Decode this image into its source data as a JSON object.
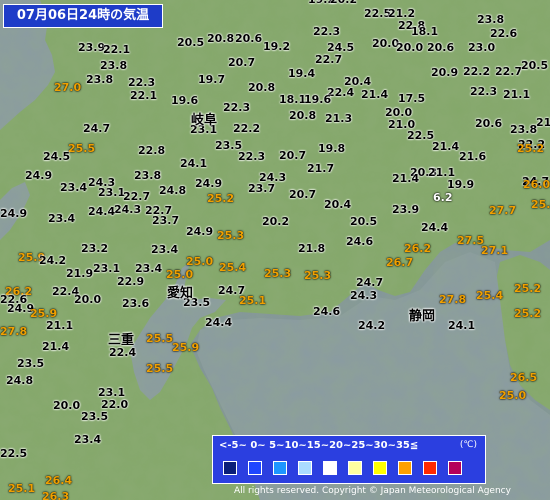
{
  "title": "07月06日24時の気温",
  "cities": [
    {
      "name": "岐阜",
      "id": "gifu"
    },
    {
      "name": "愛知",
      "id": "aichi"
    },
    {
      "name": "三重",
      "id": "mie"
    },
    {
      "name": "静岡",
      "id": "shizuoka"
    }
  ],
  "temperatures": [
    {
      "id": "t1",
      "value": "19.2"
    },
    {
      "id": "t2",
      "value": "20.2"
    },
    {
      "id": "t3",
      "value": "22.5"
    },
    {
      "id": "t4",
      "value": "21.2"
    },
    {
      "id": "t5",
      "value": "22.8"
    },
    {
      "id": "t6",
      "value": "23.8"
    },
    {
      "id": "t7",
      "value": "22.6"
    },
    {
      "id": "t8",
      "value": "20.5"
    },
    {
      "id": "t9",
      "value": "20.8"
    },
    {
      "id": "t10",
      "value": "20.6"
    },
    {
      "id": "t11",
      "value": "19.2"
    },
    {
      "id": "t12",
      "value": "22.3"
    },
    {
      "id": "t13",
      "value": "20.0"
    },
    {
      "id": "t14",
      "value": "18.1"
    },
    {
      "id": "t15",
      "value": "20.0"
    },
    {
      "id": "t16",
      "value": "20.6"
    },
    {
      "id": "t17",
      "value": "23.0"
    },
    {
      "id": "t18",
      "value": "23.9"
    },
    {
      "id": "t19",
      "value": "22.1"
    },
    {
      "id": "t20",
      "value": "24.5"
    },
    {
      "id": "t21",
      "value": "22.7"
    },
    {
      "id": "t22",
      "value": "20.7"
    },
    {
      "id": "t23",
      "value": "23.8"
    },
    {
      "id": "t24",
      "value": "19.4"
    },
    {
      "id": "t25",
      "value": "20.9"
    },
    {
      "id": "t26",
      "value": "22.2"
    },
    {
      "id": "t27",
      "value": "22.7"
    },
    {
      "id": "t28",
      "value": "20.5"
    },
    {
      "id": "t29",
      "value": "23.8"
    },
    {
      "id": "t30",
      "value": "19.7"
    },
    {
      "id": "t31",
      "value": "20.4"
    },
    {
      "id": "t32",
      "value": "27.0"
    },
    {
      "id": "t33",
      "value": "22.3"
    },
    {
      "id": "t34",
      "value": "20.8"
    },
    {
      "id": "t35",
      "value": "22.3"
    },
    {
      "id": "t36",
      "value": "22.1"
    },
    {
      "id": "t37",
      "value": "21.1"
    },
    {
      "id": "t38",
      "value": "22.4"
    },
    {
      "id": "t39",
      "value": "21.4"
    },
    {
      "id": "t40",
      "value": "17.5"
    },
    {
      "id": "t41",
      "value": "19.6"
    },
    {
      "id": "t42",
      "value": "18.1"
    },
    {
      "id": "t43",
      "value": "19.6"
    },
    {
      "id": "t44",
      "value": "22.3"
    },
    {
      "id": "t45",
      "value": "20.8"
    },
    {
      "id": "t46",
      "value": "21.3"
    },
    {
      "id": "t47",
      "value": "20.0"
    },
    {
      "id": "t48",
      "value": "21.0"
    },
    {
      "id": "t49",
      "value": "20.6"
    },
    {
      "id": "t50",
      "value": "21.6"
    },
    {
      "id": "t51",
      "value": "24.7"
    },
    {
      "id": "t52",
      "value": "23.1"
    },
    {
      "id": "t53",
      "value": "22.2"
    },
    {
      "id": "t54",
      "value": "23.8"
    },
    {
      "id": "t55",
      "value": "22.5"
    },
    {
      "id": "t56",
      "value": "22.2"
    },
    {
      "id": "t57",
      "value": "25.5"
    },
    {
      "id": "t58",
      "value": "23.5"
    },
    {
      "id": "t59",
      "value": "19.8"
    },
    {
      "id": "t60",
      "value": "21.4"
    },
    {
      "id": "t61",
      "value": "24.5"
    },
    {
      "id": "t62",
      "value": "22.8"
    },
    {
      "id": "t63",
      "value": "22.3"
    },
    {
      "id": "t64",
      "value": "20.7"
    },
    {
      "id": "t65",
      "value": "21.6"
    },
    {
      "id": "t66",
      "value": "25.2"
    },
    {
      "id": "t67",
      "value": "24.1"
    },
    {
      "id": "t68",
      "value": "21.7"
    },
    {
      "id": "t69",
      "value": "24.9"
    },
    {
      "id": "t70",
      "value": "23.8"
    },
    {
      "id": "t71",
      "value": "24.3"
    },
    {
      "id": "t72",
      "value": "24.9"
    },
    {
      "id": "t73",
      "value": "24.3"
    },
    {
      "id": "t74",
      "value": "20.3"
    },
    {
      "id": "t75",
      "value": "21.4"
    },
    {
      "id": "t76",
      "value": "21.1"
    },
    {
      "id": "t77",
      "value": "24.7"
    },
    {
      "id": "t78",
      "value": "23.4"
    },
    {
      "id": "t79",
      "value": "23.1"
    },
    {
      "id": "t80",
      "value": "24.8"
    },
    {
      "id": "t81",
      "value": "23.7"
    },
    {
      "id": "t82",
      "value": "19.9"
    },
    {
      "id": "t83",
      "value": "26.0"
    },
    {
      "id": "t84",
      "value": "22.7"
    },
    {
      "id": "t85",
      "value": "25.2"
    },
    {
      "id": "t86",
      "value": "20.7"
    },
    {
      "id": "t87",
      "value": "6.2"
    },
    {
      "id": "t88",
      "value": "24.3"
    },
    {
      "id": "t89",
      "value": "20.4"
    },
    {
      "id": "t90",
      "value": "22.7"
    },
    {
      "id": "t91",
      "value": "24.9"
    },
    {
      "id": "t92",
      "value": "24.4"
    },
    {
      "id": "t93",
      "value": "23.9"
    },
    {
      "id": "t94",
      "value": "27.7"
    },
    {
      "id": "t95",
      "value": "25.6"
    },
    {
      "id": "t96",
      "value": "23.4"
    },
    {
      "id": "t97",
      "value": "23.7"
    },
    {
      "id": "t98",
      "value": "20.2"
    },
    {
      "id": "t99",
      "value": "20.5"
    },
    {
      "id": "t100",
      "value": "24.4"
    },
    {
      "id": "t101",
      "value": "24.9"
    },
    {
      "id": "t102",
      "value": "25.3"
    },
    {
      "id": "t103",
      "value": "27.5"
    },
    {
      "id": "t104",
      "value": "23.2"
    },
    {
      "id": "t105",
      "value": "24.6"
    },
    {
      "id": "t106",
      "value": "23.4"
    },
    {
      "id": "t107",
      "value": "21.8"
    },
    {
      "id": "t108",
      "value": "26.2"
    },
    {
      "id": "t109",
      "value": "27.1"
    },
    {
      "id": "t110",
      "value": "25.9"
    },
    {
      "id": "t111",
      "value": "24.2"
    },
    {
      "id": "t112",
      "value": "25.0"
    },
    {
      "id": "t113",
      "value": "21.9"
    },
    {
      "id": "t114",
      "value": "23.1"
    },
    {
      "id": "t115",
      "value": "23.4"
    },
    {
      "id": "t116",
      "value": "25.4"
    },
    {
      "id": "t117",
      "value": "26.7"
    },
    {
      "id": "t118",
      "value": "25.0"
    },
    {
      "id": "t119",
      "value": "25.3"
    },
    {
      "id": "t120",
      "value": "25.3"
    },
    {
      "id": "t121",
      "value": "22.9"
    },
    {
      "id": "t122",
      "value": "24.7"
    },
    {
      "id": "t123",
      "value": "26.2"
    },
    {
      "id": "t124",
      "value": "22.4"
    },
    {
      "id": "t125",
      "value": "24.7"
    },
    {
      "id": "t126",
      "value": "24.3"
    },
    {
      "id": "t127",
      "value": "25.4"
    },
    {
      "id": "t128",
      "value": "25.2"
    },
    {
      "id": "t129",
      "value": "22.6"
    },
    {
      "id": "t130",
      "value": "20.0"
    },
    {
      "id": "t131",
      "value": "23.6"
    },
    {
      "id": "t132",
      "value": "23.5"
    },
    {
      "id": "t133",
      "value": "25.1"
    },
    {
      "id": "t134",
      "value": "24.6"
    },
    {
      "id": "t135",
      "value": "27.8"
    },
    {
      "id": "t136",
      "value": "24.9"
    },
    {
      "id": "t137",
      "value": "25.9"
    },
    {
      "id": "t138",
      "value": "25.2"
    },
    {
      "id": "t139",
      "value": "27.8"
    },
    {
      "id": "t140",
      "value": "21.1"
    },
    {
      "id": "t141",
      "value": "24.4"
    },
    {
      "id": "t142",
      "value": "24.2"
    },
    {
      "id": "t143",
      "value": "24.1"
    },
    {
      "id": "t144",
      "value": "25.5"
    },
    {
      "id": "t145",
      "value": "21.4"
    },
    {
      "id": "t146",
      "value": "25.9"
    },
    {
      "id": "t147",
      "value": "22.4"
    },
    {
      "id": "t148",
      "value": "23.5"
    },
    {
      "id": "t149",
      "value": "25.5"
    },
    {
      "id": "t150",
      "value": "24.8"
    },
    {
      "id": "t151",
      "value": "23.1"
    },
    {
      "id": "t152",
      "value": "26.5"
    },
    {
      "id": "t153",
      "value": "20.0"
    },
    {
      "id": "t154",
      "value": "22.0"
    },
    {
      "id": "t155",
      "value": "23.5"
    },
    {
      "id": "t156",
      "value": "25.0"
    },
    {
      "id": "t157",
      "value": "23.4"
    },
    {
      "id": "t158",
      "value": "26.4"
    },
    {
      "id": "t159",
      "value": "25.1"
    },
    {
      "id": "t160",
      "value": "26.3"
    },
    {
      "id": "t161",
      "value": "22.5"
    }
  ],
  "legend": {
    "range_text": "<-5~ 0~ 5~10~15~20~25~30~35≦",
    "unit": "(℃)",
    "colors": [
      "#0a1e7a",
      "#1e46ff",
      "#1e96ff",
      "#aadcff",
      "#ffffff",
      "#ffffa0",
      "#ffff00",
      "#ffa000",
      "#ff2800",
      "#b4005a"
    ]
  },
  "copyright": "All rights reserved. Copyright © Japan Meteorological Agency"
}
